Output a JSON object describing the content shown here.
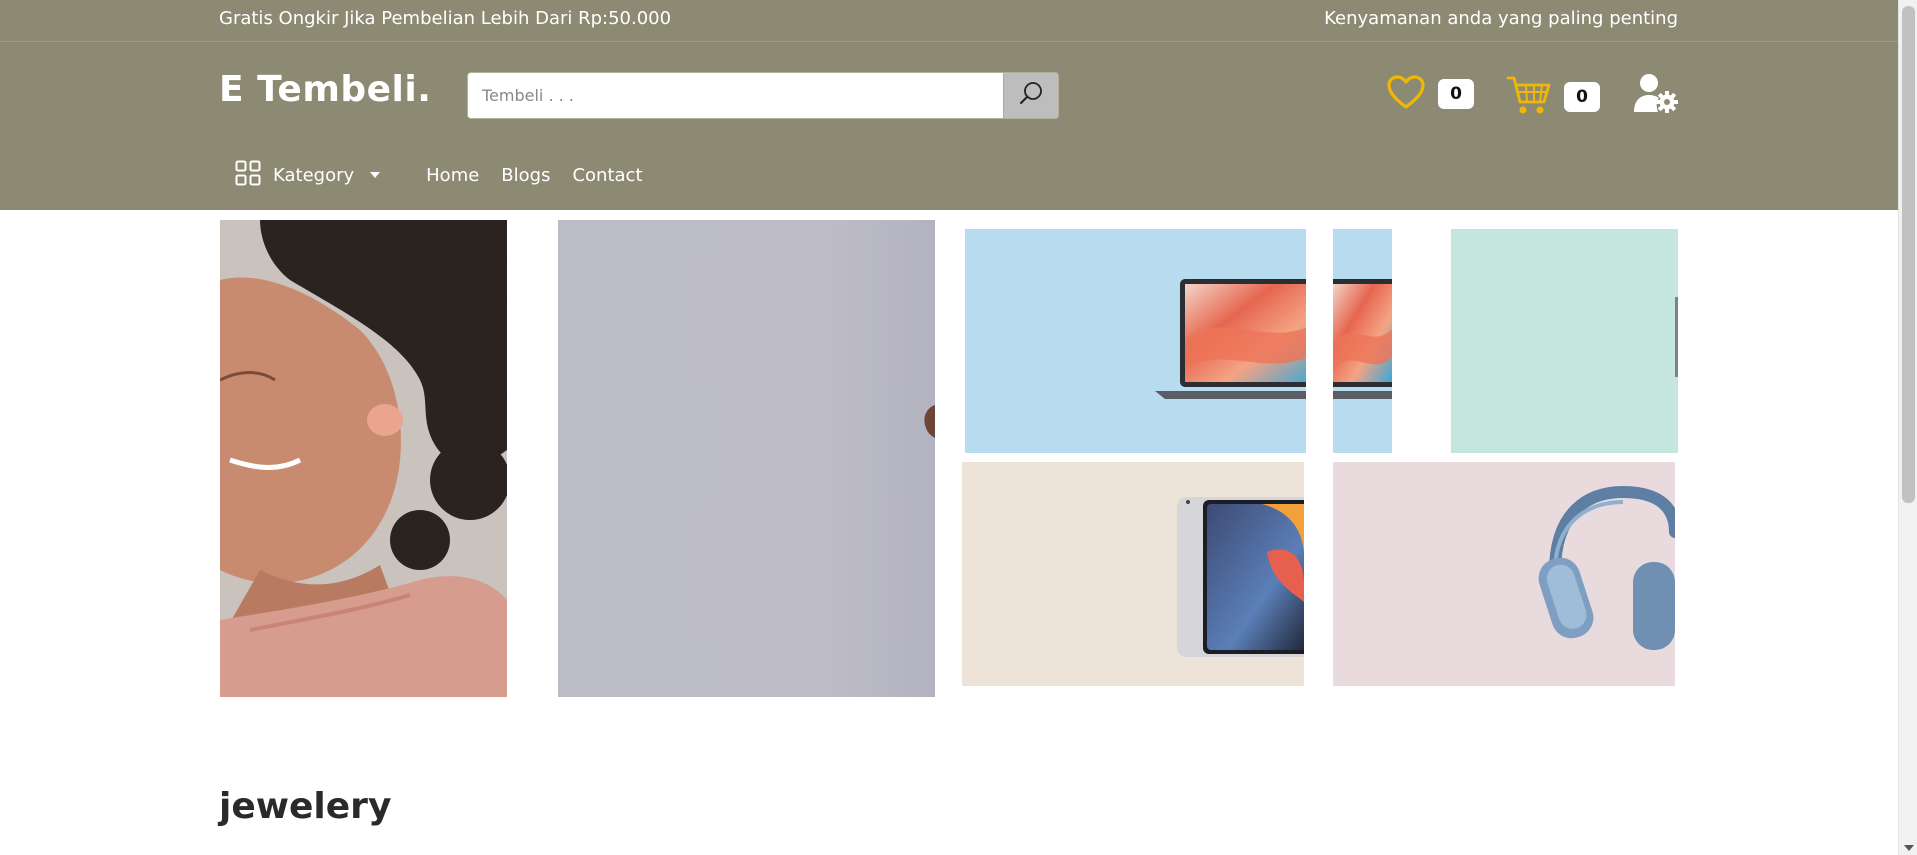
{
  "topbar": {
    "left_text": "Gratis Ongkir Jika Pembelian Lebih Dari Rp:50.000",
    "right_text": "Kenyamanan anda yang paling penting"
  },
  "header": {
    "logo": "E Tembeli.",
    "search": {
      "placeholder": "Tembeli . . .",
      "value": ""
    },
    "wishlist_count": "0",
    "cart_count": "0"
  },
  "nav": {
    "category_label": "Kategory",
    "links": [
      "Home",
      "Blogs",
      "Contact"
    ]
  },
  "banners": [
    {
      "subject": "woman wearing earbuds"
    },
    {
      "subject": "grey banner with partial object"
    },
    {
      "subject": "laptop on light blue background"
    },
    {
      "subject": "laptop cropped on light blue background"
    },
    {
      "subject": "mint green banner"
    },
    {
      "subject": "tablet on beige background"
    },
    {
      "subject": "headphones on pink background"
    }
  ],
  "section": {
    "title": "jewelery"
  },
  "colors": {
    "header_bg": "#8c8a72",
    "accent_icon": "#f2b705",
    "white": "#ffffff"
  },
  "icons": [
    "grid-icon",
    "search-icon",
    "heart-icon",
    "cart-icon",
    "user-gear-icon"
  ]
}
